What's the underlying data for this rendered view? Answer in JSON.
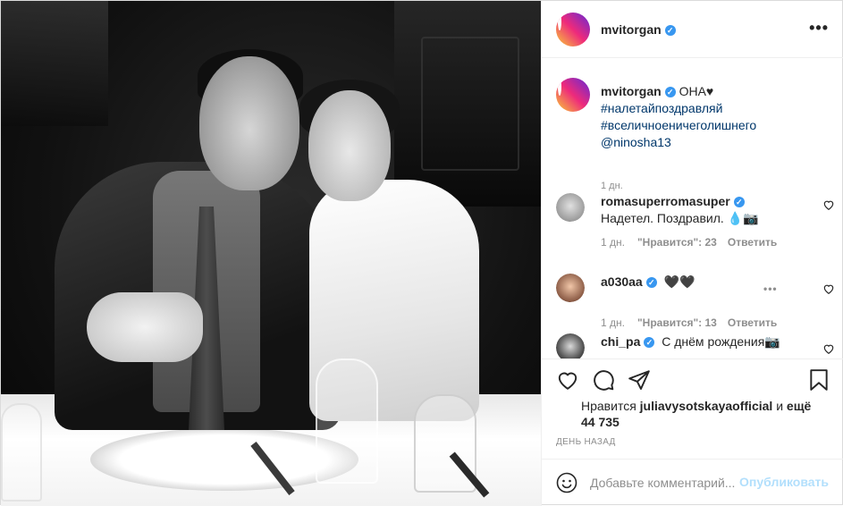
{
  "post": {
    "author": "mvitorgan",
    "verified_mark": "✓",
    "more_label": "•••"
  },
  "caption": {
    "username": "mvitorgan",
    "text": "ОНА♥",
    "hashtags": [
      "#налетайпоздравляй",
      "#вселичноеничеголишнего"
    ],
    "mention": "@ninosha13",
    "time": "1 дн."
  },
  "comments": [
    {
      "username": "romasuperromasuper",
      "text": "Надетел. Поздравил. 💧📷",
      "time": "1 дн.",
      "likes": "\"Нравится\": 23",
      "reply": "Ответить",
      "more": "",
      "avatar_color": "#b9b9b9"
    },
    {
      "username": "a030aa",
      "text": "🖤🖤",
      "time": "1 дн.",
      "likes": "\"Нравится\": 13",
      "reply": "Ответить",
      "more": "•••",
      "avatar_color": "#8a6a5a"
    },
    {
      "username": "chi_pa",
      "text": "С днём рождения📷",
      "time": "",
      "likes": "",
      "reply": "",
      "more": "",
      "avatar_color": "#2f2f2f"
    }
  ],
  "actions": {
    "like_icon": "heart-icon",
    "comment_icon": "comment-icon",
    "share_icon": "share-icon",
    "save_icon": "bookmark-icon"
  },
  "likes": {
    "prefix": "Нравится",
    "user": "juliavysotskayaofficial",
    "suffix": "и",
    "others": "ещё 44 735"
  },
  "posted": "День назад",
  "add_comment": {
    "placeholder": "Добавьте комментарий...",
    "post_label": "Опубликовать"
  },
  "colors": {
    "verified": "#3897f0",
    "hashtag": "#00376b",
    "muted": "#8e8e8e",
    "post_disabled": "#b2dffc"
  }
}
